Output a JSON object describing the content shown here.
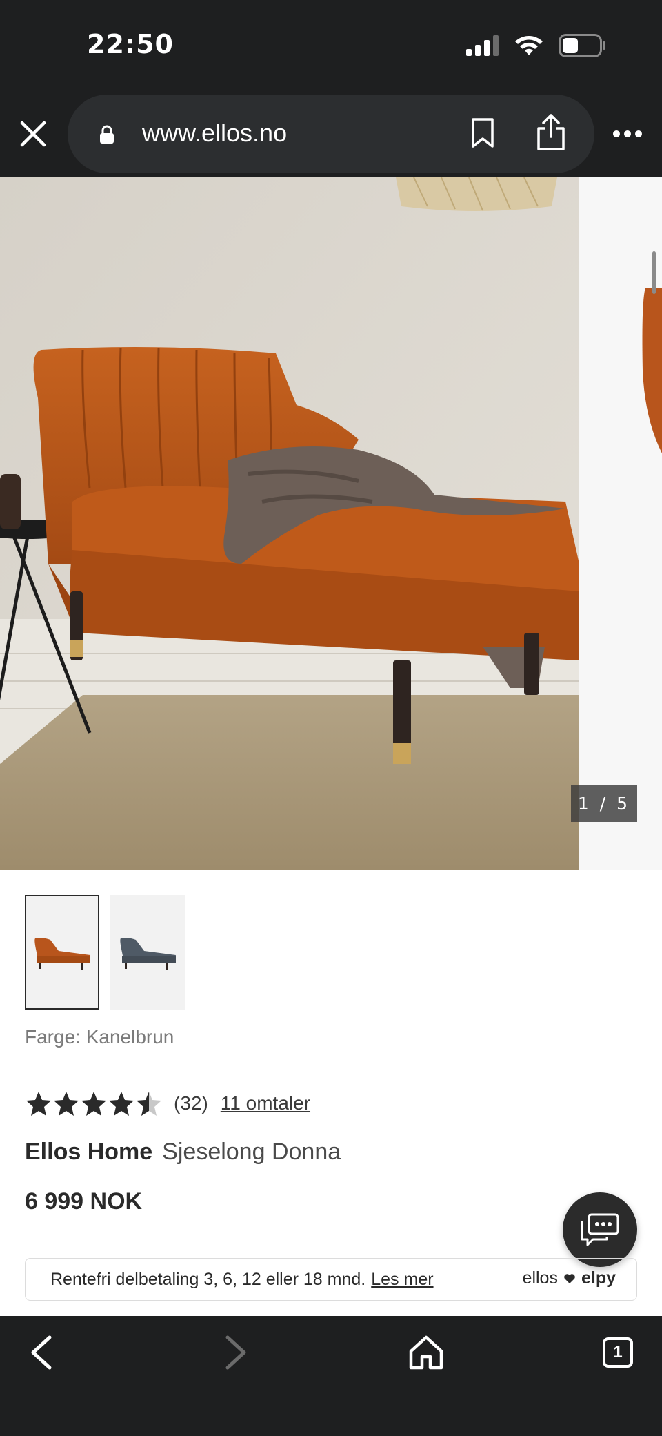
{
  "status_bar": {
    "time": "22:50",
    "icons": [
      "signal-icon",
      "wifi-icon",
      "battery-icon"
    ]
  },
  "browser": {
    "url": "www.ellos.no",
    "icons": [
      "close-icon",
      "lock-icon",
      "bookmark-icon",
      "share-icon",
      "more-icon"
    ]
  },
  "gallery": {
    "counter": "1 / 5",
    "current_index": 1,
    "total": 5
  },
  "thumbnails": [
    {
      "color": "#b8551c",
      "selected": true
    },
    {
      "color": "#4f5a66",
      "selected": false
    }
  ],
  "product": {
    "color_label": "Farge: Kanelbrun",
    "rating_value": 4.5,
    "rating_max": 5,
    "rating_count": "(32)",
    "reviews_link": "11 omtaler",
    "brand": "Ellos Home",
    "name": "Sjeselong Donna",
    "price": "6 999 NOK"
  },
  "finance": {
    "text": "Rentefri delbetaling 3, 6, 12 eller 18 mnd.",
    "link": "Les mer",
    "partner_a": "ellos",
    "partner_b": "elpy"
  },
  "bottom_nav": {
    "tab_count": "1",
    "icons": [
      "back-icon",
      "forward-icon",
      "home-icon",
      "tabs-icon"
    ]
  },
  "colors": {
    "chrome": "#1e1f20",
    "sofa": "#b8551c",
    "accent_text": "#2a2a2a"
  }
}
